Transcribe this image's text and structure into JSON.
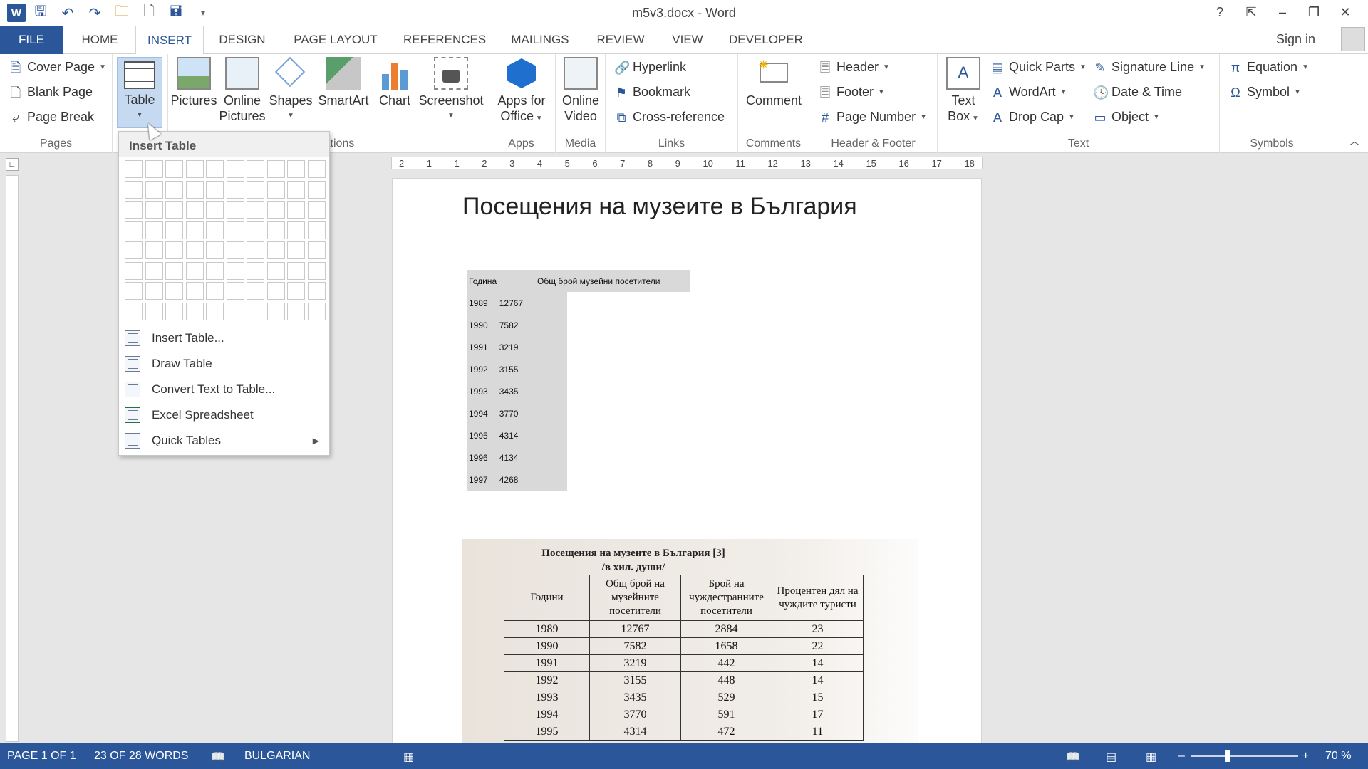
{
  "app": {
    "title": "m5v3.docx - Word",
    "sign_in": "Sign in"
  },
  "qat": {
    "logo": "W"
  },
  "window_controls": {
    "help": "?",
    "restore_ribbon": "⇱",
    "minimize": "–",
    "maximize": "❐",
    "close": "✕"
  },
  "tabs": [
    "HOME",
    "INSERT",
    "DESIGN",
    "PAGE LAYOUT",
    "REFERENCES",
    "MAILINGS",
    "REVIEW",
    "VIEW",
    "DEVELOPER"
  ],
  "file_tab": "FILE",
  "ribbon": {
    "pages": {
      "label": "Pages",
      "cover_page": "Cover Page",
      "blank_page": "Blank Page",
      "page_break": "Page Break"
    },
    "tables": {
      "table": "Table"
    },
    "illustrations": {
      "pictures": "Pictures",
      "online_pictures_1": "Online",
      "online_pictures_2": "Pictures",
      "shapes": "Shapes",
      "smartart": "SmartArt",
      "chart": "Chart",
      "screenshot": "Screenshot",
      "label_partial": "ations"
    },
    "apps": {
      "label": "Apps",
      "apps_office_1": "Apps for",
      "apps_office_2": "Office"
    },
    "media": {
      "label": "Media",
      "online_video_1": "Online",
      "online_video_2": "Video"
    },
    "links": {
      "label": "Links",
      "hyperlink": "Hyperlink",
      "bookmark": "Bookmark",
      "cross_reference": "Cross-reference"
    },
    "comments": {
      "label": "Comments",
      "comment": "Comment"
    },
    "header_footer": {
      "label": "Header & Footer",
      "header": "Header",
      "footer": "Footer",
      "page_number": "Page Number"
    },
    "text": {
      "label": "Text",
      "text_box_1": "Text",
      "text_box_2": "Box",
      "quick_parts": "Quick Parts",
      "wordart": "WordArt",
      "drop_cap": "Drop Cap",
      "signature_line": "Signature Line",
      "date_time": "Date & Time",
      "object": "Object"
    },
    "symbols": {
      "label": "Symbols",
      "equation": "Equation",
      "symbol": "Symbol"
    }
  },
  "insert_table_menu": {
    "header": "Insert Table",
    "grid_cols": 10,
    "grid_rows": 8,
    "items": [
      "Insert Table...",
      "Draw Table",
      "Convert Text to Table...",
      "Excel Spreadsheet",
      "Quick Tables"
    ]
  },
  "ruler_numbers": [
    "2",
    "1",
    "1",
    "2",
    "3",
    "4",
    "5",
    "6",
    "7",
    "8",
    "9",
    "10",
    "11",
    "12",
    "13",
    "14",
    "15",
    "16",
    "17",
    "18"
  ],
  "document": {
    "title": "Посещения на музеите в България",
    "table_header": [
      "Година",
      "Общ брой музейни посетители"
    ],
    "table_rows": [
      [
        "1989",
        "12767"
      ],
      [
        "1990",
        "7582"
      ],
      [
        "1991",
        "3219"
      ],
      [
        "1992",
        "3155"
      ],
      [
        "1993",
        "3435"
      ],
      [
        "1994",
        "3770"
      ],
      [
        "1995",
        "4314"
      ],
      [
        "1996",
        "4134"
      ],
      [
        "1997",
        "4268"
      ]
    ],
    "scan": {
      "title_1": "Посещения на музеите в България [3]",
      "title_2": "/в хил. души/",
      "headers": [
        "Години",
        "Общ брой на музейните посетители",
        "Брой на чуждестранните посетители",
        "Процентен дял на чуждите туристи"
      ],
      "rows": [
        [
          "1989",
          "12767",
          "2884",
          "23"
        ],
        [
          "1990",
          "7582",
          "1658",
          "22"
        ],
        [
          "1991",
          "3219",
          "442",
          "14"
        ],
        [
          "1992",
          "3155",
          "448",
          "14"
        ],
        [
          "1993",
          "3435",
          "529",
          "15"
        ],
        [
          "1994",
          "3770",
          "591",
          "17"
        ],
        [
          "1995",
          "4314",
          "472",
          "11"
        ]
      ]
    }
  },
  "status": {
    "page": "PAGE 1 OF 1",
    "words": "23 OF 28 WORDS",
    "language": "BULGARIAN",
    "zoom": "70 %",
    "zoom_minus": "–",
    "zoom_plus": "+"
  },
  "colors": {
    "accent": "#2b579a",
    "table_shade": "#d9d9d9"
  }
}
